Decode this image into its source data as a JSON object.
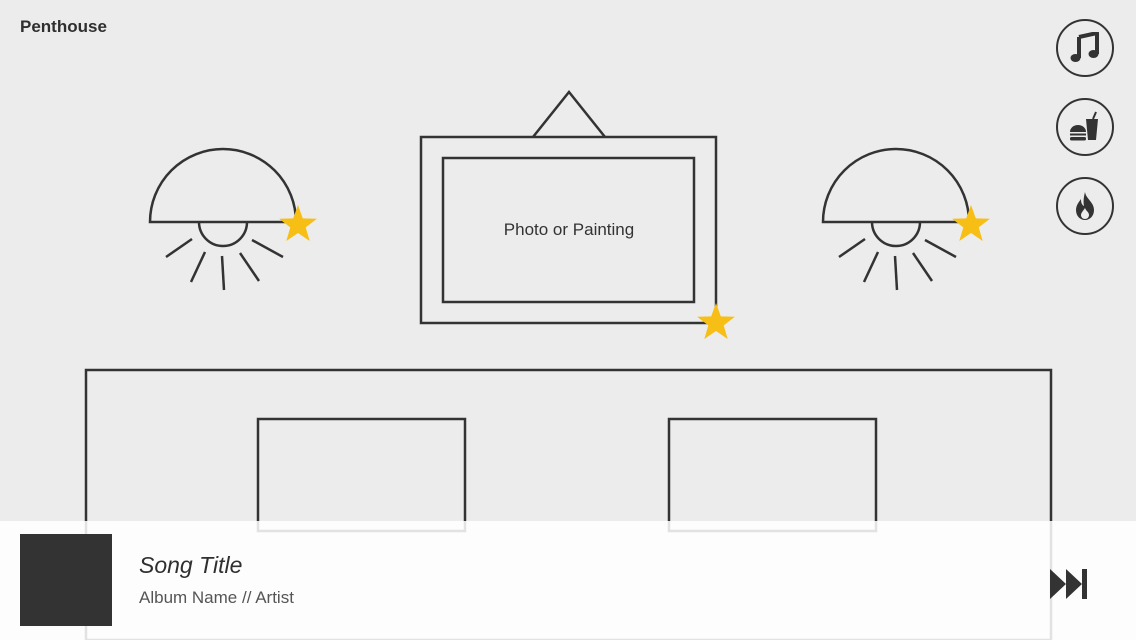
{
  "room": {
    "title": "Penthouse"
  },
  "painting": {
    "label": "Photo or Painting"
  },
  "side_buttons": [
    {
      "icon": "music-note-icon"
    },
    {
      "icon": "food-drink-icon"
    },
    {
      "icon": "fire-icon"
    }
  ],
  "hotspot_markers": [
    {
      "icon": "star-icon",
      "attached_to": "lamp-left"
    },
    {
      "icon": "star-icon",
      "attached_to": "painting"
    },
    {
      "icon": "star-icon",
      "attached_to": "lamp-right"
    }
  ],
  "player": {
    "song_title": "Song Title",
    "song_subtitle": "Album Name // Artist",
    "skip_icon": "skip-forward-icon"
  },
  "colors": {
    "background": "#ececec",
    "line": "#333333",
    "accent_star": "#f7be16",
    "player_bg": "#ffffff"
  }
}
